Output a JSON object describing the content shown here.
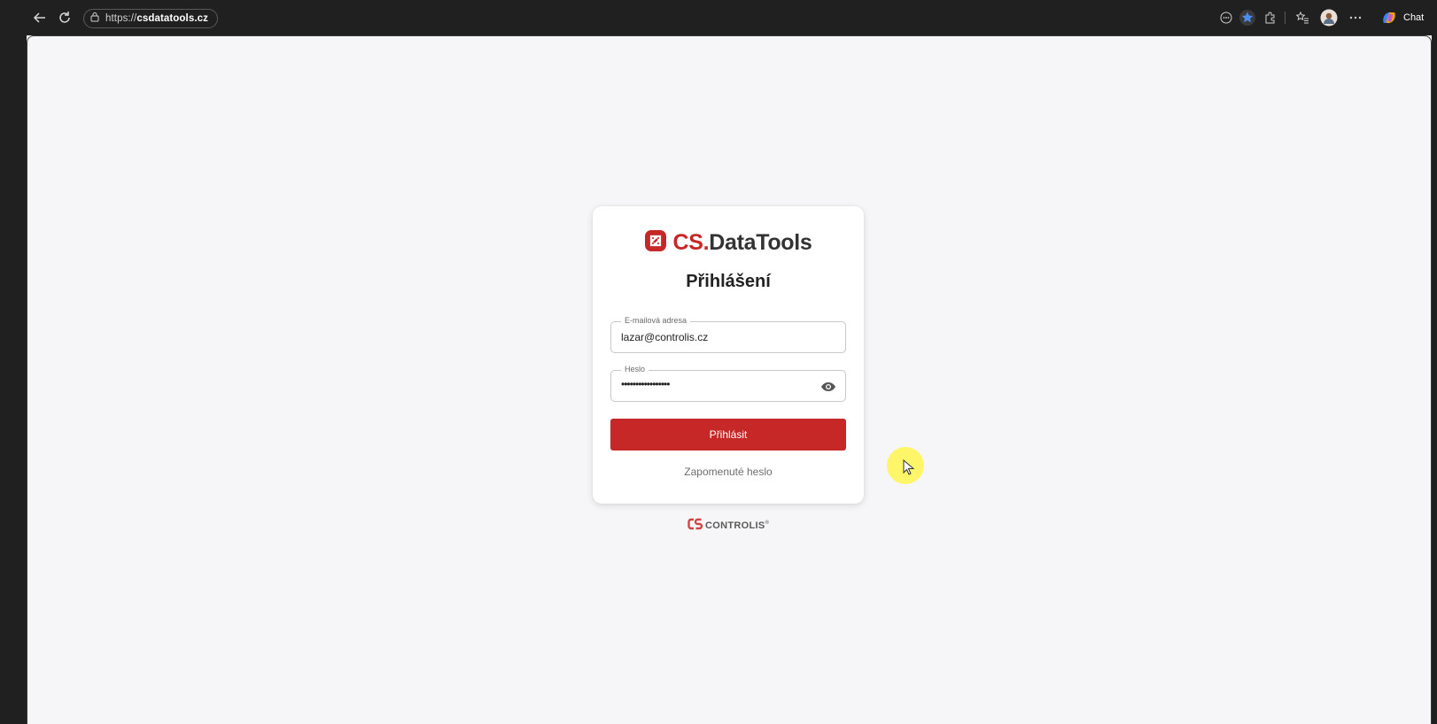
{
  "browser": {
    "url_prefix": "https://",
    "url_host": "csdatatools.cz",
    "chat_label": "Chat",
    "icons": [
      "back-arrow-icon",
      "reload-icon",
      "lock-icon",
      "reading-mode-icon",
      "favorite-star-icon",
      "extensions-icon",
      "favorites-list-icon",
      "profile-avatar-icon",
      "more-icon",
      "copilot-icon"
    ]
  },
  "login": {
    "brand_cs": "CS.",
    "brand_rest": "DataTools",
    "title": "Přihlášení",
    "email": {
      "label": "E-mailová adresa",
      "value": "lazar@controlis.cz"
    },
    "password": {
      "label": "Heslo",
      "value_masked": "•••••••••••••••••"
    },
    "submit_label": "Přihlásit",
    "forgot_label": "Zapomenuté heslo"
  },
  "footer": {
    "brand": "CONTROLIS",
    "registered": "®"
  },
  "colors": {
    "accent": "#c62828",
    "page_background": "#f6f6f8",
    "browser_chrome": "#202020"
  }
}
